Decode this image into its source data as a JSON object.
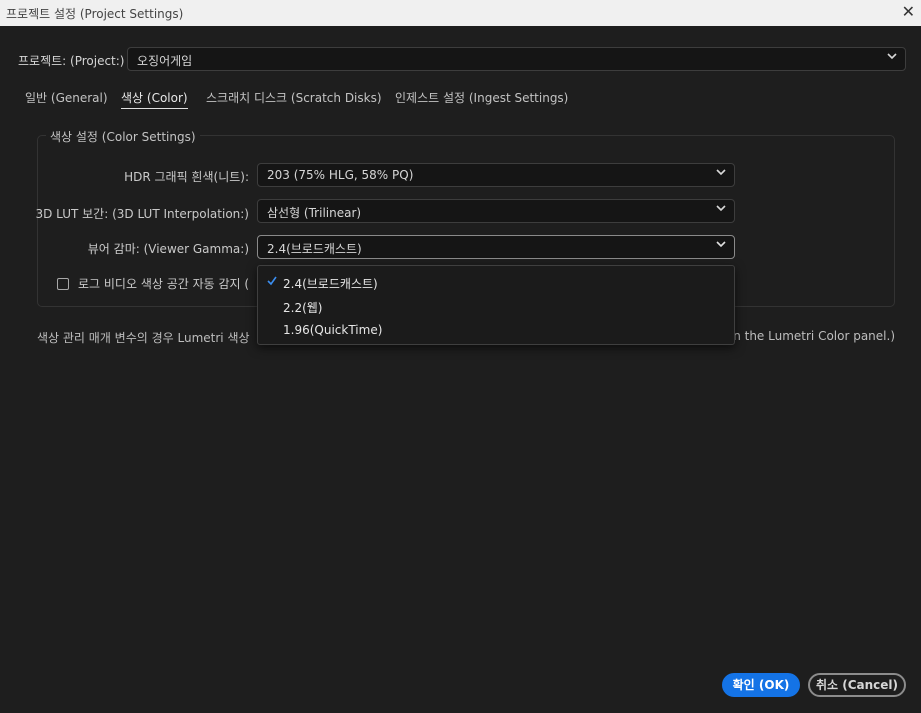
{
  "window": {
    "title": "프로젝트 설정 (Project Settings)",
    "close_glyph": "✕"
  },
  "project": {
    "label": "프로젝트: (Project:)",
    "value": "오징어게임"
  },
  "tabs": [
    {
      "label": "일반 (General)",
      "active": false
    },
    {
      "label": "색상 (Color)",
      "active": true
    },
    {
      "label": "스크래치 디스크 (Scratch Disks)",
      "active": false
    },
    {
      "label": "인제스트 설정 (Ingest Settings)",
      "active": false
    }
  ],
  "color_settings": {
    "legend": "색상 설정 (Color Settings)",
    "hdr_white": {
      "label": "HDR 그래픽 흰색(니트):",
      "value": "203 (75% HLG, 58% PQ)"
    },
    "lut_interp": {
      "label": "3D LUT 보간: (3D LUT Interpolation:)",
      "value": "삼선형 (Trilinear)"
    },
    "viewer_gamma": {
      "label": "뷰어 감마: (Viewer Gamma:)",
      "value": "2.4(브로드캐스트)",
      "options": [
        {
          "label": "2.4(브로드캐스트)",
          "selected": true
        },
        {
          "label": "2.2(웹)",
          "selected": false
        },
        {
          "label": "1.96(QuickTime)",
          "selected": false
        }
      ]
    },
    "auto_detect": {
      "label": "로그 비디오 색상 공간 자동 감지 (",
      "checked": false
    }
  },
  "note": {
    "left": "색상 관리 매개 변수의 경우 Lumetri 색상",
    "right": "ab in the Lumetri Color panel.)"
  },
  "buttons": {
    "ok": "확인 (OK)",
    "cancel": "취소 (Cancel)"
  },
  "icons": {
    "chevron": "chevron-down-icon",
    "check": "checkmark-icon",
    "close": "close-icon"
  },
  "colors": {
    "accent": "#1473e6",
    "check": "#3b8ef0",
    "background": "#1e1e1e"
  }
}
